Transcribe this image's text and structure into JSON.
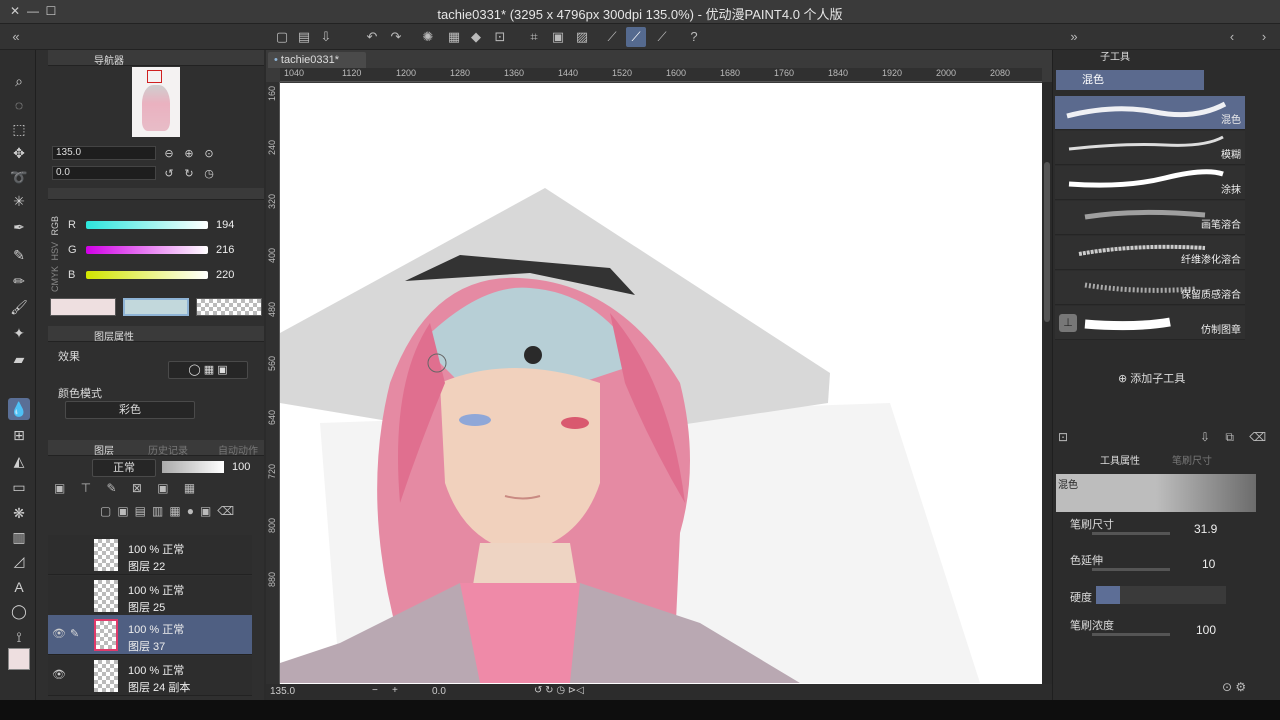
{
  "window": {
    "title": "tachie0331* (3295 x 4796px 300dpi 135.0%) - 优动漫PAINT4.0 个人版"
  },
  "navigator": {
    "tab_label": "导航器",
    "zoom": "135.0",
    "rotate": "0.0"
  },
  "color_sliders": {
    "modes": [
      "RGB",
      "HSV",
      "CMYK"
    ],
    "channels": [
      {
        "label": "R",
        "value": "194"
      },
      {
        "label": "G",
        "value": "216"
      },
      {
        "label": "B",
        "value": "220"
      }
    ],
    "main_color": "#eedfe0",
    "sub_color": "#c2d8dc"
  },
  "layer_properties": {
    "tab_label": "图层属性",
    "effect_label": "效果",
    "color_mode_label": "颜色模式",
    "color_mode_value": "彩色"
  },
  "layers_panel": {
    "tabs": [
      "图层",
      "历史记录",
      "自动动作"
    ],
    "blend_mode": "正常",
    "opacity": "100",
    "rows": [
      {
        "percent": "100 %",
        "mode": "正常",
        "name": "图层 22",
        "selected": false,
        "visible": false
      },
      {
        "percent": "100 %",
        "mode": "正常",
        "name": "图层 25",
        "selected": false,
        "visible": false
      },
      {
        "percent": "100 %",
        "mode": "正常",
        "name": "图层 37",
        "selected": true,
        "visible": true
      },
      {
        "percent": "100 %",
        "mode": "正常",
        "name": "图层 24 副本",
        "selected": false,
        "visible": true
      }
    ]
  },
  "canvas": {
    "tab_name": "tachie0331*",
    "ruler_h": [
      "1040",
      "1120",
      "1200",
      "1280",
      "1360",
      "1440",
      "1520",
      "1600",
      "1680",
      "1760",
      "1840",
      "1920",
      "2000",
      "2080"
    ],
    "ruler_v": [
      "160",
      "240",
      "320",
      "400",
      "480",
      "560",
      "640",
      "720",
      "800",
      "880"
    ],
    "status_zoom": "135.0",
    "status_rotate": "0.0"
  },
  "sub_tool": {
    "header": "子工具",
    "group": "混色",
    "brushes": [
      "混色",
      "模糊",
      "涂抹",
      "画笔溶合",
      "纤维渗化溶合",
      "保留质感溶合",
      "仿制图章"
    ],
    "add_label": "添加子工具"
  },
  "tool_property": {
    "tabs": [
      "工具属性",
      "笔刷尺寸"
    ],
    "tool_name": "混色",
    "brush_size_label": "笔刷尺寸",
    "brush_size": "31.9",
    "color_extension_label": "色延伸",
    "color_extension": "10",
    "hardness_label": "硬度",
    "brush_density_label": "笔刷浓度",
    "brush_density": "100"
  }
}
